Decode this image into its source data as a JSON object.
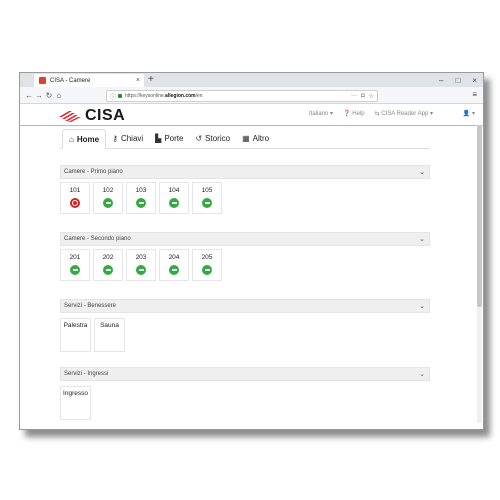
{
  "browser": {
    "tab_title": "CISA - Camere",
    "url_prefix": "https://keysonline.",
    "url_domain": "allegion.com",
    "url_suffix": "/en",
    "close_glyph": "×",
    "new_tab_glyph": "+",
    "controls": [
      "–",
      "□",
      "×"
    ],
    "nav": {
      "back": "←",
      "forward": "→",
      "reload": "↻",
      "home": "⌂",
      "menu": "≡"
    }
  },
  "app": {
    "brand": "CISA",
    "brand_color": "#e0232b",
    "header_menu": {
      "language": "Italiano ▾",
      "help": "Help",
      "reader": "CISA Reader App ▾",
      "user": "▾"
    },
    "tabs": [
      {
        "label": "Home",
        "icon": "home-icon",
        "active": true
      },
      {
        "label": "Chiavi",
        "icon": "key-icon",
        "active": false
      },
      {
        "label": "Porte",
        "icon": "door-icon",
        "active": false
      },
      {
        "label": "Storico",
        "icon": "history-icon",
        "active": false
      },
      {
        "label": "Altro",
        "icon": "grid-icon",
        "active": false
      }
    ],
    "sections": [
      {
        "title": "Camere - Primo piano",
        "cards": [
          {
            "label": "101",
            "status": "alarm"
          },
          {
            "label": "102",
            "status": "ok"
          },
          {
            "label": "103",
            "status": "ok"
          },
          {
            "label": "104",
            "status": "ok"
          },
          {
            "label": "105",
            "status": "ok"
          }
        ]
      },
      {
        "title": "Camere - Secondo piano",
        "cards": [
          {
            "label": "201",
            "status": "ok"
          },
          {
            "label": "202",
            "status": "ok"
          },
          {
            "label": "203",
            "status": "ok"
          },
          {
            "label": "204",
            "status": "ok"
          },
          {
            "label": "205",
            "status": "ok"
          }
        ]
      },
      {
        "title": "Servizi - Benessere",
        "cards": [
          {
            "label": "Palestra"
          },
          {
            "label": "Sauna"
          }
        ]
      },
      {
        "title": "Servizi - Ingressi",
        "cards": [
          {
            "label": "Ingresso"
          }
        ]
      }
    ],
    "colors": {
      "ok": "#35a943",
      "alarm": "#d6202a",
      "accent": "#e0232b"
    }
  }
}
